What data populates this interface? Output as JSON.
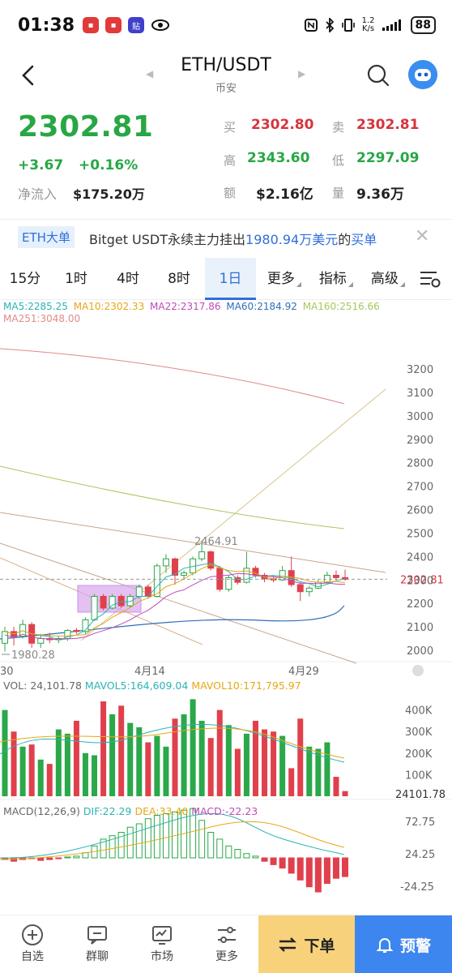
{
  "status_bar": {
    "time": "01:38",
    "net_speed": "1.2\nK/s",
    "battery": "88"
  },
  "header": {
    "title": "ETH/USDT",
    "exchange": "币安"
  },
  "price": {
    "last": "2302.81",
    "change": "+3.67",
    "change_pct": "+0.16%",
    "inflow_label": "净流入",
    "inflow_value": "$175.20万",
    "buy_label": "买",
    "buy_value": "2302.80",
    "sell_label": "卖",
    "sell_value": "2302.81",
    "high_label": "高",
    "high_value": "2343.60",
    "low_label": "低",
    "low_value": "2297.09",
    "amount_label": "额",
    "amount_value": "$2.16亿",
    "volume_label": "量",
    "volume_value": "9.36万"
  },
  "banner": {
    "tag": "ETH大单",
    "text_prefix": "Bitget USDT永续主力挂出",
    "amount": "1980.94万美元",
    "text_mid": "的",
    "side": "买单"
  },
  "tabs": [
    {
      "label": "15分"
    },
    {
      "label": "1时"
    },
    {
      "label": "4时"
    },
    {
      "label": "8时"
    },
    {
      "label": "1日"
    },
    {
      "label": "更多"
    },
    {
      "label": "指标"
    },
    {
      "label": "高级"
    }
  ],
  "active_tab": "1日",
  "ma_legend": [
    {
      "label": "MA5:2285.25",
      "color": "#2bb3b3"
    },
    {
      "label": "MA10:2302.33",
      "color": "#e6a817"
    },
    {
      "label": "MA22:2317.86",
      "color": "#c04ab8"
    },
    {
      "label": "MA60:2184.92",
      "color": "#2f6fb8"
    },
    {
      "label": "MA160:2516.66",
      "color": "#a6c85a"
    },
    {
      "label": "MA251:3048.00",
      "color": "#e08a8a"
    }
  ],
  "vol_legend": [
    {
      "label": "VOL: 24,101.78",
      "color": "#666"
    },
    {
      "label": "MAVOL5:164,609.04",
      "color": "#2bb3b3"
    },
    {
      "label": "MAVOL10:171,795.97",
      "color": "#e6a817"
    }
  ],
  "macd_legend": [
    {
      "label": "MACD(12,26,9)",
      "color": "#666"
    },
    {
      "label": "DIF:22.29",
      "color": "#2bb3b3"
    },
    {
      "label": "DEA:33.40",
      "color": "#e6a817"
    },
    {
      "label": "MACD:-22.23",
      "color": "#c04ab8"
    }
  ],
  "chart_data": {
    "type": "candlestick",
    "price_axis": [
      "3200",
      "3100",
      "3000",
      "2900",
      "2800",
      "2700",
      "2600",
      "2500",
      "2400",
      "2300",
      "2200",
      "2100",
      "2000"
    ],
    "current_price_tag": "2302.81",
    "high_marker": "2464.91",
    "low_marker": "1980.28",
    "date_labels": [
      "30",
      "4月14",
      "4月29"
    ],
    "volume_axis": [
      "400K",
      "300K",
      "200K",
      "100K"
    ],
    "volume_current": "24101.78",
    "macd_axis": [
      "72.75",
      "24.25",
      "-24.25"
    ],
    "candles": [
      {
        "o": 2030,
        "c": 2080,
        "h": 2100,
        "l": 1995
      },
      {
        "o": 2080,
        "c": 2060,
        "h": 2100,
        "l": 2020
      },
      {
        "o": 2060,
        "c": 2110,
        "h": 2130,
        "l": 2050
      },
      {
        "o": 2110,
        "c": 2030,
        "h": 2120,
        "l": 2010
      },
      {
        "o": 2030,
        "c": 2050,
        "h": 2070,
        "l": 2010
      },
      {
        "o": 2050,
        "c": 2045,
        "h": 2075,
        "l": 2030
      },
      {
        "o": 2045,
        "c": 2050,
        "h": 2060,
        "l": 2030
      },
      {
        "o": 2050,
        "c": 2085,
        "h": 2090,
        "l": 2040
      },
      {
        "o": 2085,
        "c": 2080,
        "h": 2095,
        "l": 2070
      },
      {
        "o": 2080,
        "c": 2130,
        "h": 2140,
        "l": 2070
      },
      {
        "o": 2130,
        "c": 2230,
        "h": 2240,
        "l": 2125
      },
      {
        "o": 2230,
        "c": 2180,
        "h": 2240,
        "l": 2170
      },
      {
        "o": 2180,
        "c": 2230,
        "h": 2240,
        "l": 2175
      },
      {
        "o": 2230,
        "c": 2190,
        "h": 2240,
        "l": 2180
      },
      {
        "o": 2190,
        "c": 2230,
        "h": 2240,
        "l": 2180
      },
      {
        "o": 2230,
        "c": 2270,
        "h": 2280,
        "l": 2220
      },
      {
        "o": 2270,
        "c": 2230,
        "h": 2280,
        "l": 2220
      },
      {
        "o": 2230,
        "c": 2360,
        "h": 2370,
        "l": 2225
      },
      {
        "o": 2360,
        "c": 2390,
        "h": 2410,
        "l": 2330
      },
      {
        "o": 2390,
        "c": 2320,
        "h": 2395,
        "l": 2280
      },
      {
        "o": 2320,
        "c": 2330,
        "h": 2340,
        "l": 2300
      },
      {
        "o": 2330,
        "c": 2390,
        "h": 2400,
        "l": 2320
      },
      {
        "o": 2390,
        "c": 2420,
        "h": 2465,
        "l": 2380
      },
      {
        "o": 2420,
        "c": 2350,
        "h": 2425,
        "l": 2340
      },
      {
        "o": 2350,
        "c": 2260,
        "h": 2360,
        "l": 2250
      },
      {
        "o": 2260,
        "c": 2310,
        "h": 2320,
        "l": 2250
      },
      {
        "o": 2310,
        "c": 2290,
        "h": 2320,
        "l": 2280
      },
      {
        "o": 2290,
        "c": 2350,
        "h": 2420,
        "l": 2285
      },
      {
        "o": 2350,
        "c": 2320,
        "h": 2360,
        "l": 2310
      },
      {
        "o": 2320,
        "c": 2305,
        "h": 2330,
        "l": 2290
      },
      {
        "o": 2305,
        "c": 2300,
        "h": 2320,
        "l": 2290
      },
      {
        "o": 2300,
        "c": 2340,
        "h": 2360,
        "l": 2295
      },
      {
        "o": 2340,
        "c": 2280,
        "h": 2400,
        "l": 2270
      },
      {
        "o": 2280,
        "c": 2250,
        "h": 2290,
        "l": 2210
      },
      {
        "o": 2250,
        "c": 2265,
        "h": 2275,
        "l": 2230
      },
      {
        "o": 2265,
        "c": 2290,
        "h": 2300,
        "l": 2260
      },
      {
        "o": 2290,
        "c": 2320,
        "h": 2335,
        "l": 2285
      },
      {
        "o": 2320,
        "c": 2310,
        "h": 2340,
        "l": 2300
      },
      {
        "o": 2310,
        "c": 2302.81,
        "h": 2343.6,
        "l": 2297.09
      }
    ],
    "volumes": [
      400,
      300,
      230,
      240,
      170,
      150,
      310,
      290,
      350,
      200,
      190,
      440,
      380,
      420,
      340,
      320,
      250,
      280,
      230,
      360,
      380,
      450,
      350,
      270,
      400,
      330,
      220,
      290,
      350,
      310,
      300,
      280,
      130,
      360,
      230,
      220,
      250,
      90,
      24
    ],
    "macd_hist": [
      -2,
      -4,
      -2,
      -1,
      -3,
      -2,
      -1,
      1,
      2,
      6,
      14,
      22,
      26,
      30,
      36,
      40,
      46,
      50,
      52,
      54,
      56,
      58,
      44,
      30,
      22,
      14,
      10,
      5,
      2,
      -4,
      -8,
      -12,
      -18,
      -26,
      -34,
      -40,
      -30,
      -24,
      -22
    ]
  },
  "bottom_nav": {
    "watchlist": "自选",
    "chat": "群聊",
    "market": "市场",
    "more": "更多",
    "order": "下单",
    "alert": "预警"
  }
}
